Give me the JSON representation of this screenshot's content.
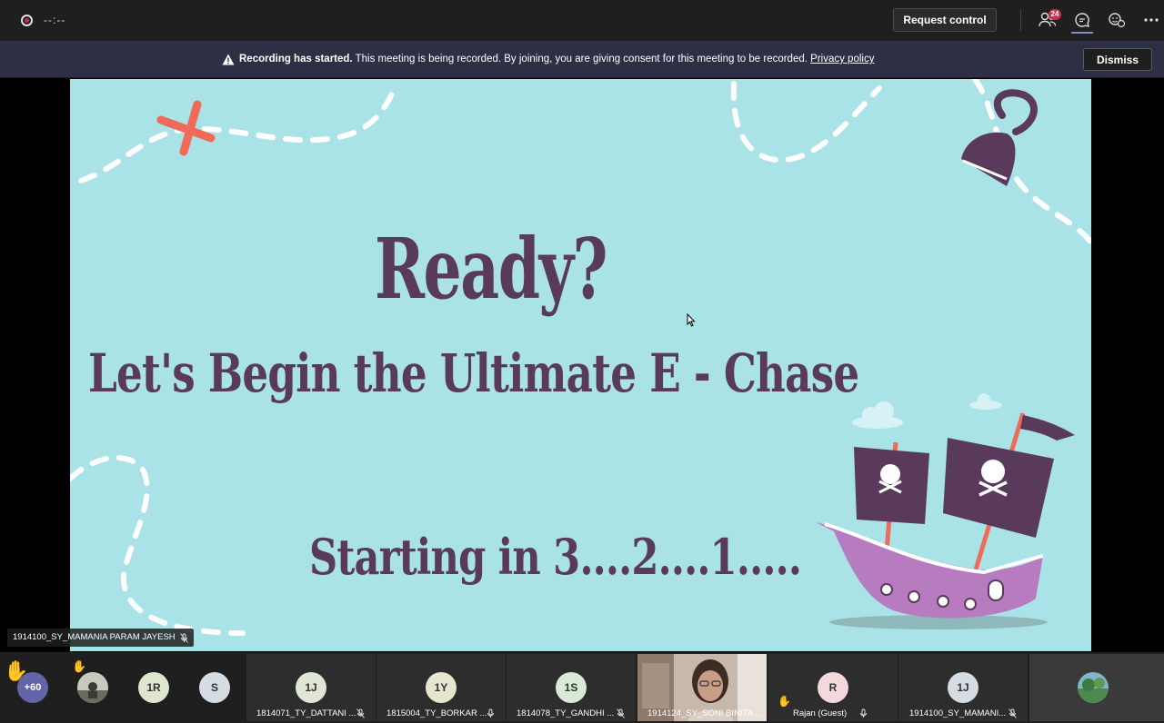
{
  "top_bar": {
    "timer": "--:--",
    "request_control": "Request control",
    "participants_badge": "24",
    "icons": [
      "record-icon",
      "participants-icon",
      "chat-icon",
      "reactions-icon",
      "more-icon"
    ]
  },
  "banner": {
    "bold_text": "Recording has started.",
    "text": " This meeting is being recorded. By joining, you are giving consent for this meeting to be recorded.",
    "link": "Privacy policy",
    "dismiss": "Dismiss"
  },
  "slide": {
    "title": "Ready?",
    "subtitle": "Let's Begin the Ultimate E - Chase",
    "countdown": "Starting in 3....2....1....."
  },
  "speaker": {
    "name": "1914100_SY_MAMANIA PARAM JAYESH"
  },
  "gallery": {
    "overflow_count": "+60",
    "small_avatars": [
      {
        "initials": "1R"
      },
      {
        "initials": "S"
      }
    ],
    "tiles": [
      {
        "initials": "1J",
        "name": "1814071_TY_DATTANI ..."
      },
      {
        "initials": "1Y",
        "name": "1815004_TY_BORKAR ..."
      },
      {
        "initials": "1S",
        "name": "1814078_TY_GANDHI ..."
      },
      {
        "initials": "",
        "name": "1914124_SY_SONI BINITA ..."
      },
      {
        "initials": "R",
        "name": "Rajan (Guest)"
      },
      {
        "initials": "1J",
        "name": "1914100_SY_MAMANI..."
      }
    ]
  },
  "colors": {
    "slide_bg": "#a9e3e8",
    "slide_text": "#5a3a5c",
    "banner_bg": "#2d2f45",
    "accent": "#8b8cc7",
    "badge": "#c4314b"
  }
}
